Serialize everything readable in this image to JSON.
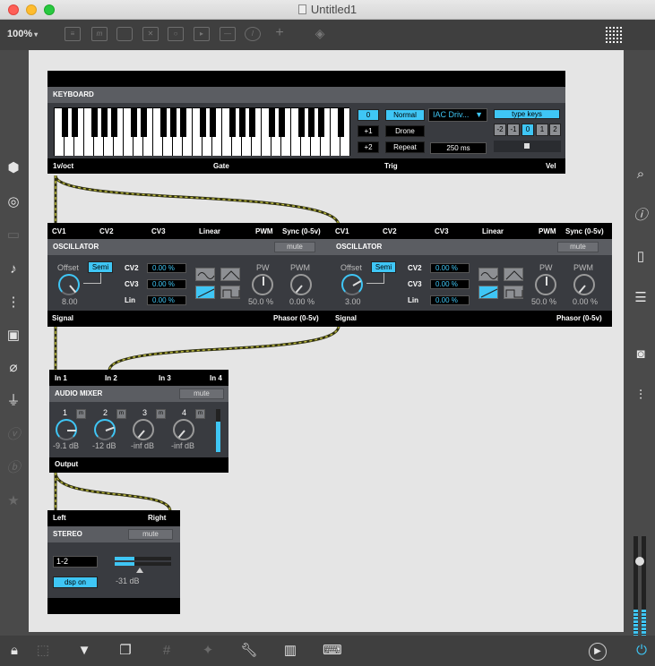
{
  "window": {
    "title": "Untitled1"
  },
  "toolbar": {
    "zoom": "100%",
    "icons": [
      "presentation-icon",
      "message-icon",
      "comment-icon",
      "button-icon",
      "toggle-icon",
      "number-icon",
      "slider-icon",
      "dial-icon",
      "plus-icon",
      "paint-icon"
    ]
  },
  "keyboard": {
    "title": "KEYBOARD",
    "octave_buttons": [
      "0",
      "+1",
      "+2"
    ],
    "mode_buttons": [
      "Normal",
      "Drone",
      "Repeat"
    ],
    "device": "IAC Driv...",
    "time": "250 ms",
    "type_keys": "type keys",
    "octave_select": [
      "-2",
      "-1",
      "0",
      "1",
      "2"
    ],
    "outputs": [
      "1v/oct",
      "Gate",
      "Trig",
      "Vel"
    ]
  },
  "osc1": {
    "inputs": [
      "CV1",
      "CV2",
      "CV3",
      "Linear",
      "PWM",
      "Sync (0-5v)"
    ],
    "title": "OSCILLATOR",
    "mute": "mute",
    "offset_label": "Offset",
    "semi": "Semi",
    "offset_value": "8.00",
    "cv_labels": [
      "CV2",
      "CV3",
      "Lin"
    ],
    "cv_values": [
      "0.00 %",
      "0.00 %",
      "0.00 %"
    ],
    "pw_label": "PW",
    "pw_value": "50.0 %",
    "pwm_label": "PWM",
    "pwm_value": "0.00 %",
    "outputs": [
      "Signal",
      "Phasor (0-5v)"
    ]
  },
  "osc2": {
    "inputs": [
      "CV1",
      "CV2",
      "CV3",
      "Linear",
      "PWM",
      "Sync (0-5v)"
    ],
    "title": "OSCILLATOR",
    "mute": "mute",
    "offset_label": "Offset",
    "semi": "Semi",
    "offset_value": "3.00",
    "cv_labels": [
      "CV2",
      "CV3",
      "Lin"
    ],
    "cv_values": [
      "0.00 %",
      "0.00 %",
      "0.00 %"
    ],
    "pw_label": "PW",
    "pw_value": "50.0 %",
    "pwm_label": "PWM",
    "pwm_value": "0.00 %",
    "outputs": [
      "Signal",
      "Phasor (0-5v)"
    ]
  },
  "mixer": {
    "inputs": [
      "In 1",
      "In 2",
      "In 3",
      "In 4"
    ],
    "title": "AUDIO MIXER",
    "mute": "mute",
    "channels": [
      {
        "num": "1",
        "m": "m",
        "value": "-9.1 dB"
      },
      {
        "num": "2",
        "m": "m",
        "value": "-12 dB"
      },
      {
        "num": "3",
        "m": "m",
        "value": "-inf dB"
      },
      {
        "num": "4",
        "m": "m",
        "value": "-inf dB"
      }
    ],
    "output": "Output"
  },
  "stereo": {
    "inputs": [
      "Left",
      "Right"
    ],
    "title": "STEREO",
    "mute": "mute",
    "channels": "1-2",
    "dsp": "dsp on",
    "level": "-31 dB"
  },
  "colors": {
    "accent": "#3fc6f5",
    "cable": "#3c3c10",
    "cable_dash": "#b7b63c",
    "module_bg": "#393b40",
    "header_bg": "#5b5d62"
  }
}
